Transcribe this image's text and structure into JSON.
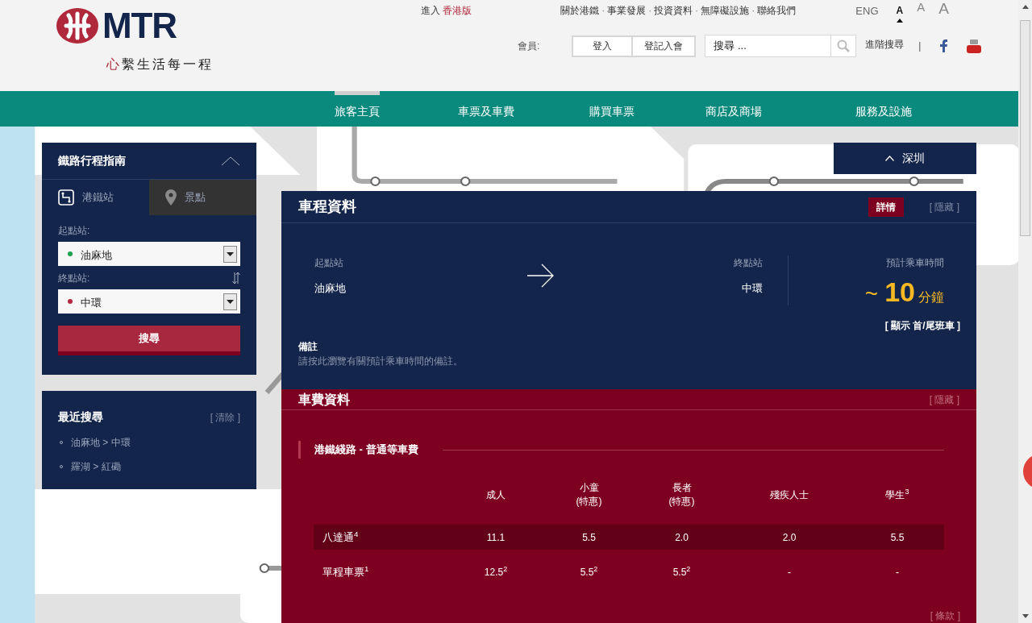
{
  "header": {
    "region_link": {
      "prefix": "進入",
      "label": "香港版"
    },
    "logo": {
      "text": "MTR",
      "tagline_mark": "心",
      "tagline": "繫生活每一程"
    },
    "top_links": [
      "關於港鐵",
      "事業發展",
      "投資資料",
      "無障礙設施",
      "聯絡我們"
    ],
    "separator": "·",
    "language": "ENG",
    "font_sizes": [
      {
        "label": "A",
        "selected": true
      },
      {
        "label": "A",
        "selected": false
      },
      {
        "label": "A",
        "selected": false
      }
    ],
    "member": {
      "label": "會員:",
      "buttons": [
        "登入",
        "登記入會"
      ]
    },
    "search": {
      "placeholder": "搜尋 ..."
    },
    "advanced_search": "進階搜尋",
    "divider": "|"
  },
  "nav": [
    {
      "label": "旅客主頁",
      "selected": true
    },
    {
      "label": "車票及車費",
      "selected": false
    },
    {
      "label": "購買車票",
      "selected": false
    },
    {
      "label": "商店及商場",
      "selected": false
    },
    {
      "label": "服務及設施",
      "selected": false
    }
  ],
  "journey_planner": {
    "title": "鐵路行程指南",
    "tabs": [
      {
        "label": "港鐵站",
        "selected": true
      },
      {
        "label": "景點",
        "selected": false
      }
    ],
    "origin": {
      "label": "起點站:",
      "value": "油麻地",
      "color": "#1aa34a"
    },
    "destination": {
      "label": "終點站:",
      "value": "中環",
      "color": "#b5283e"
    },
    "search_button": "搜尋"
  },
  "recent": {
    "title": "最近搜尋",
    "clear": "[ 清除 ]",
    "items": [
      "油麻地 > 中環",
      "羅湖 > 紅磡"
    ]
  },
  "region_button": "深圳",
  "trip": {
    "title": "車程資料",
    "details_button": "詳情",
    "hide": "[ 隱藏 ]",
    "origin_label": "起點站",
    "origin": "油麻地",
    "destination_label": "終點站",
    "destination": "中環",
    "time_label": "預計乘車時間",
    "time_prefix": "~",
    "time_value": "10",
    "time_unit": "分鐘",
    "first_last": "[ 顯示 首/尾班車 ]",
    "notes_title": "備註",
    "notes_text": "請按此瀏覽有關預計乘車時間的備註。"
  },
  "fares": {
    "title": "車費資料",
    "hide": "[ 隱藏 ]",
    "section": "港鐵綫路 - 普通等車費",
    "columns": [
      "成人",
      "小童\n(特惠)",
      "長者\n(特惠)",
      "殘疾人士",
      "學生$^{3}$"
    ],
    "rows": [
      {
        "label": "八達通$^{4}$",
        "shaded": true,
        "cells": [
          "11.1",
          "5.5",
          "2.0",
          "2.0",
          "5.5"
        ]
      },
      {
        "label": "單程車票$^{1}$",
        "shaded": false,
        "cells": [
          "12.5$^{2}$",
          "5.5$^{2}$",
          "5.5$^{2}$",
          "-",
          "-"
        ]
      }
    ],
    "terms": "[ 條款 ]"
  }
}
